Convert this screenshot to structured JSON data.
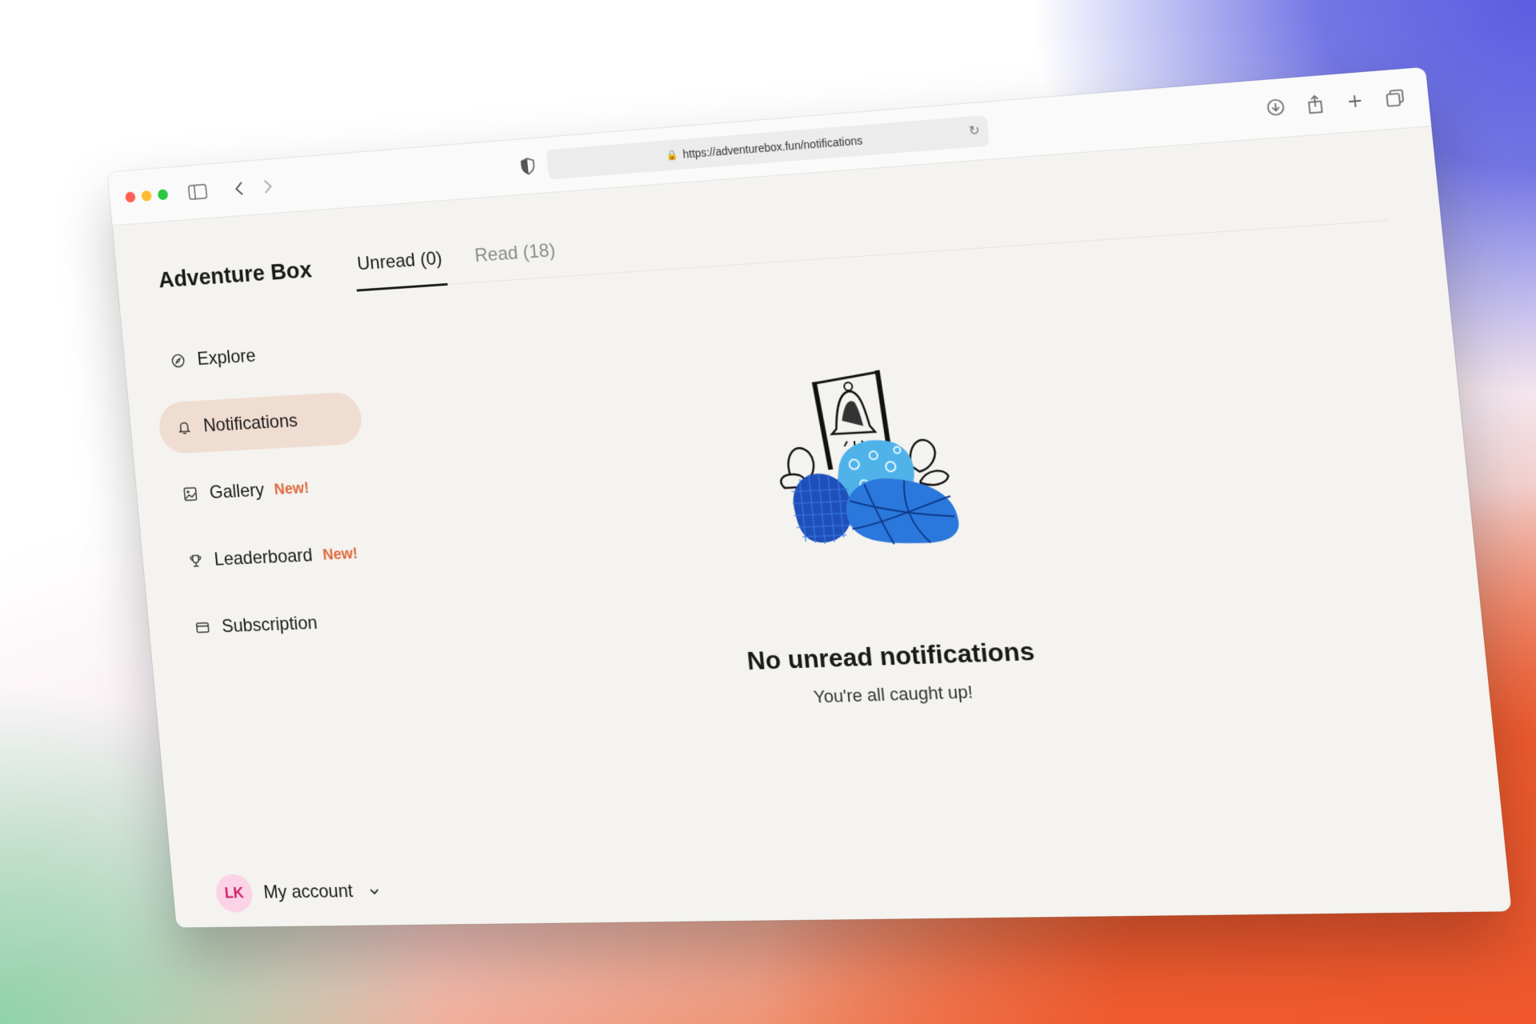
{
  "browser": {
    "url": "https://adventurebox.fun/notifications",
    "icons": [
      "sidebar-icon",
      "back-icon",
      "forward-icon",
      "shield-icon",
      "lock-icon",
      "reload-icon",
      "download-icon",
      "share-icon",
      "new-tab-icon",
      "tabs-overview-icon"
    ]
  },
  "app": {
    "brand": "Adventure Box",
    "tabs": [
      {
        "label": "Unread (0)",
        "active": true
      },
      {
        "label": "Read (18)",
        "active": false
      }
    ],
    "nav": [
      {
        "label": "Explore",
        "icon": "compass-icon",
        "badge": ""
      },
      {
        "label": "Notifications",
        "icon": "bell-icon",
        "badge": "",
        "active": true
      },
      {
        "label": "Gallery",
        "icon": "image-icon",
        "badge": "New!"
      },
      {
        "label": "Leaderboard",
        "icon": "trophy-icon",
        "badge": "New!"
      },
      {
        "label": "Subscription",
        "icon": "card-icon",
        "badge": ""
      }
    ],
    "empty_state": {
      "title": "No unread notifications",
      "subtitle": "You're all caught up!"
    },
    "account": {
      "initials": "LK",
      "label": "My account"
    }
  },
  "colors": {
    "active_nav_bg": "#f0ddd2",
    "new_badge": "#e06a3f",
    "avatar_bg": "#fbd3e6",
    "avatar_text": "#d0246a",
    "illustration_blue": "#1f6fd1",
    "illustration_light_blue": "#4fb3ea"
  }
}
